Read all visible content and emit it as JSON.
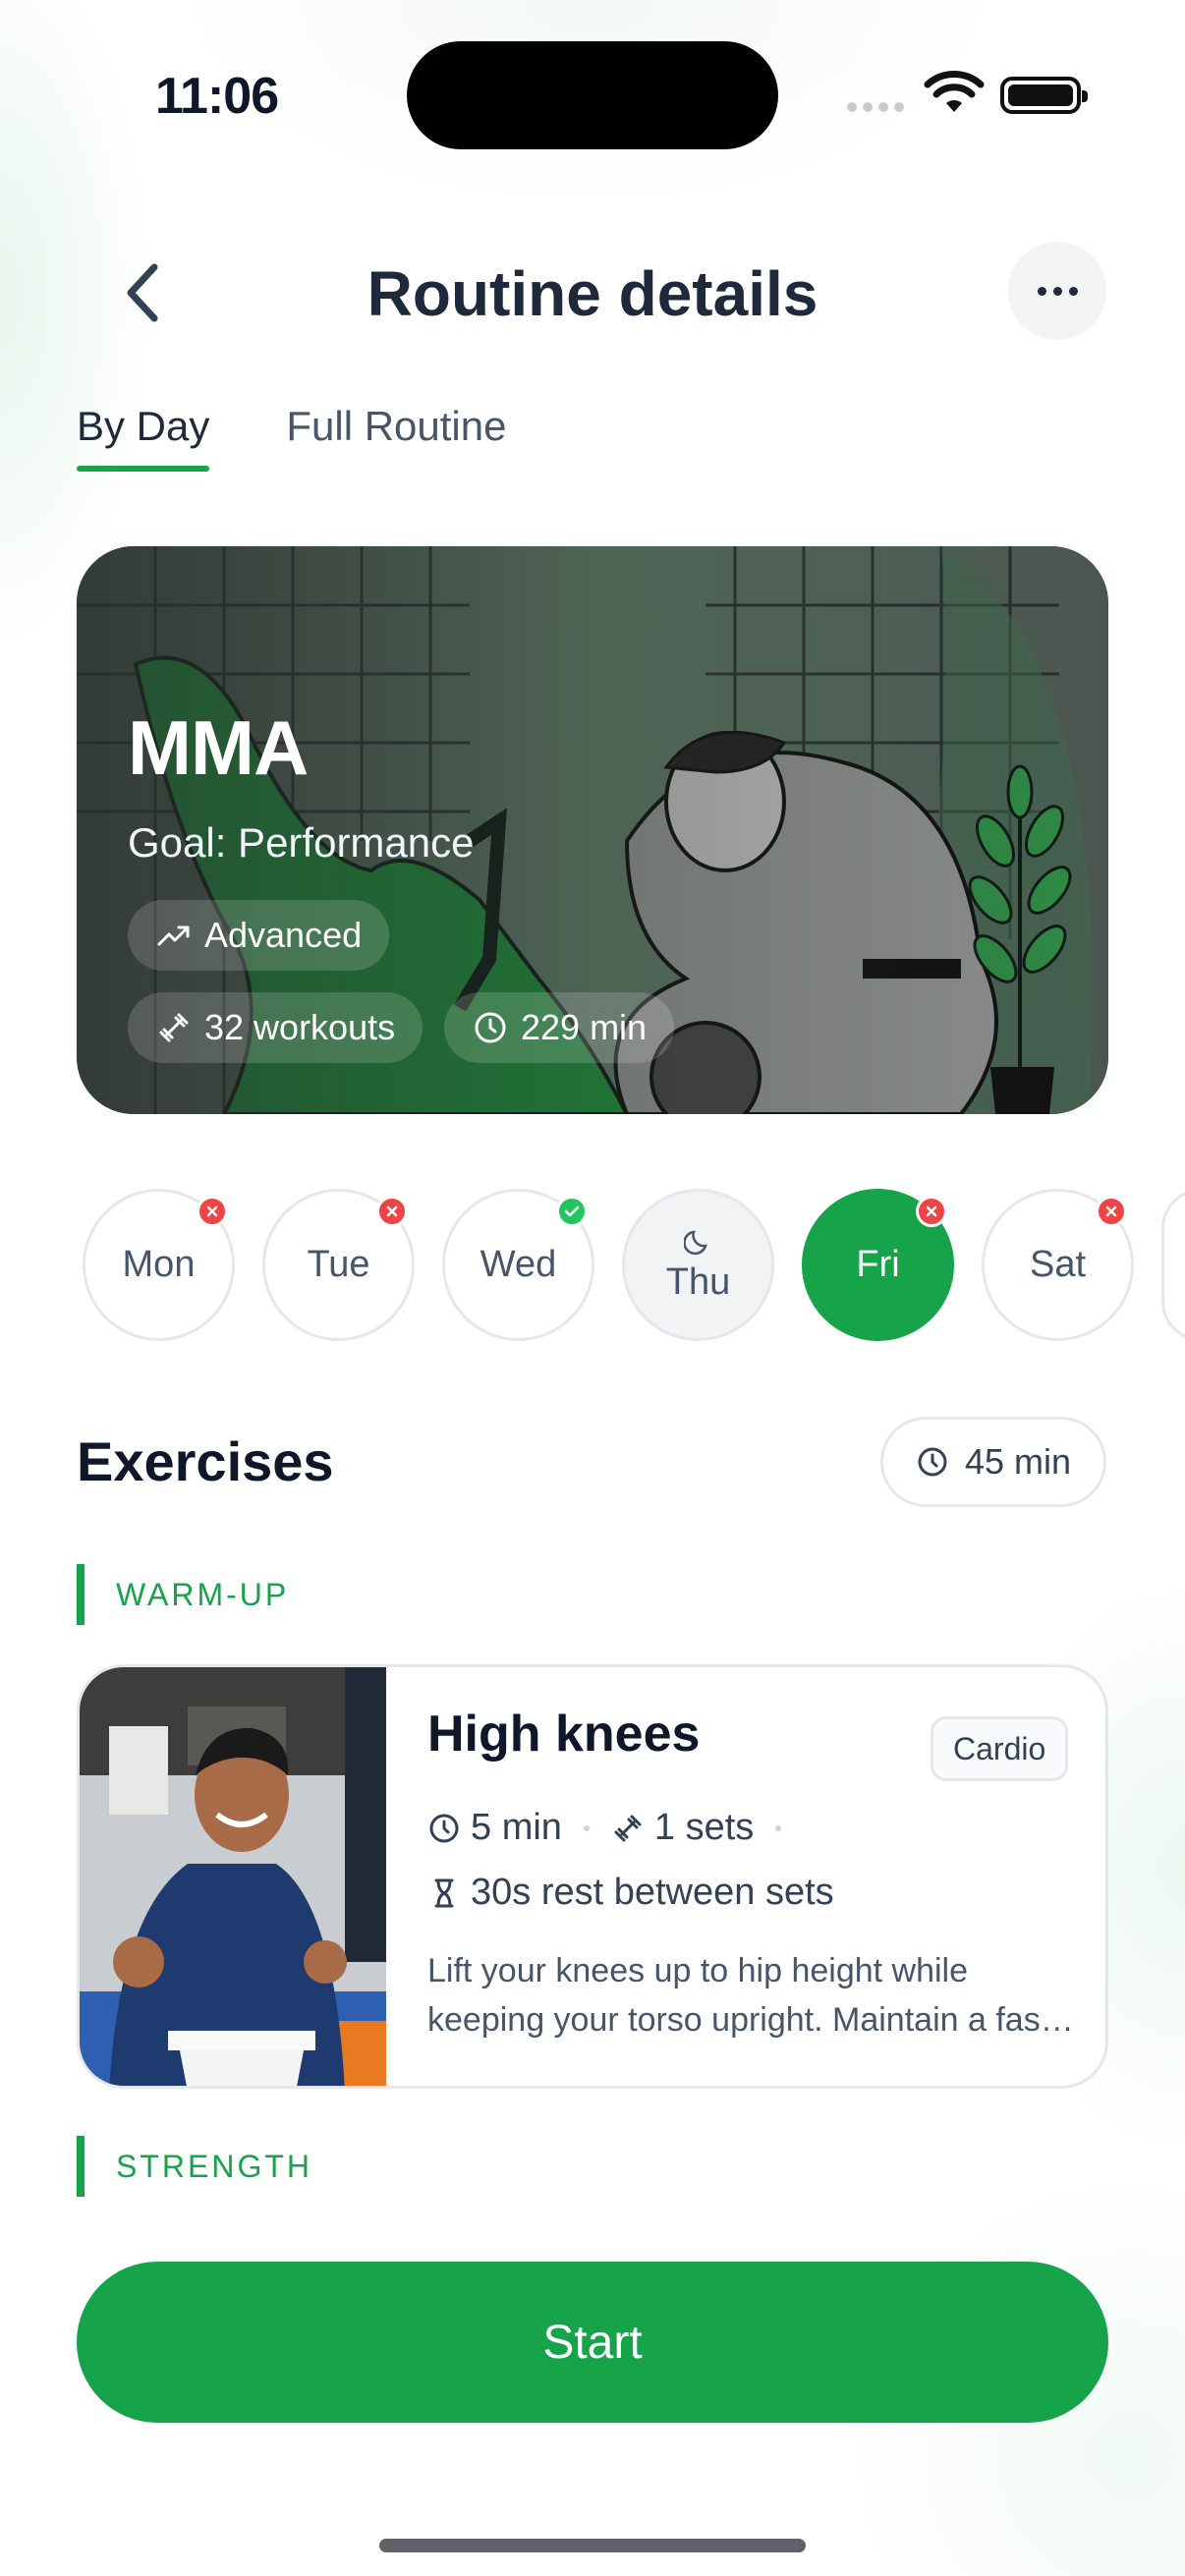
{
  "status_bar": {
    "time": "11:06"
  },
  "header": {
    "title": "Routine details",
    "back_icon": "chevron-left-icon",
    "more_icon": "ellipsis-icon"
  },
  "tabs": [
    {
      "label": "By Day",
      "active": true
    },
    {
      "label": "Full Routine",
      "active": false
    }
  ],
  "hero": {
    "title": "MMA",
    "goal": "Goal: Performance",
    "level": "Advanced",
    "workouts": "32 workouts",
    "duration": "229 min"
  },
  "days": [
    {
      "label": "Mon",
      "status": "missed"
    },
    {
      "label": "Tue",
      "status": "missed"
    },
    {
      "label": "Wed",
      "status": "done"
    },
    {
      "label": "Thu",
      "status": "rest"
    },
    {
      "label": "Fri",
      "status": "missed",
      "selected": true
    },
    {
      "label": "Sat",
      "status": "missed"
    }
  ],
  "exercises": {
    "title": "Exercises",
    "total_duration": "45 min",
    "sections": [
      {
        "label": "WARM-UP"
      },
      {
        "label": "STRENGTH"
      }
    ],
    "items": [
      {
        "name": "High knees",
        "tag": "Cardio",
        "duration": "5 min",
        "sets": "1 sets",
        "rest": "30s rest between sets",
        "description": "Lift your knees up to hip height while keeping your torso upright. Maintain a fast pace."
      }
    ]
  },
  "start_label": "Start",
  "colors": {
    "accent": "#16a34a",
    "danger": "#ef4444",
    "success": "#22c55e",
    "text": "#0f172a"
  }
}
